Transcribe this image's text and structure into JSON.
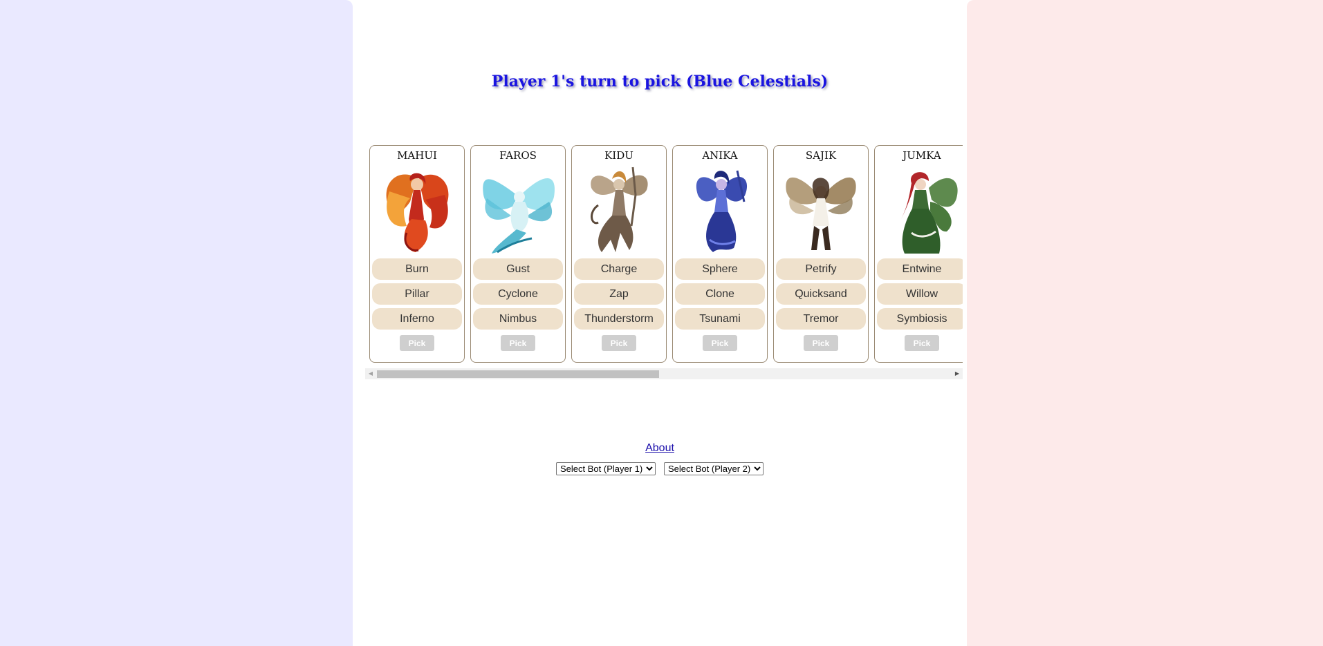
{
  "turn_title": "Player 1's turn to pick (Blue Celestials)",
  "cards": [
    {
      "name": "MAHUI",
      "image": "fire-fairy-portrait",
      "spells": [
        "Burn",
        "Pillar",
        "Inferno"
      ],
      "pick_label": "Pick"
    },
    {
      "name": "FAROS",
      "image": "wind-fairy-portrait",
      "spells": [
        "Gust",
        "Cyclone",
        "Nimbus"
      ],
      "pick_label": "Pick"
    },
    {
      "name": "KIDU",
      "image": "lightning-fairy-portrait",
      "spells": [
        "Charge",
        "Zap",
        "Thunderstorm"
      ],
      "pick_label": "Pick"
    },
    {
      "name": "ANIKA",
      "image": "water-fairy-portrait",
      "spells": [
        "Sphere",
        "Clone",
        "Tsunami"
      ],
      "pick_label": "Pick"
    },
    {
      "name": "SAJIK",
      "image": "earth-fairy-portrait",
      "spells": [
        "Petrify",
        "Quicksand",
        "Tremor"
      ],
      "pick_label": "Pick"
    },
    {
      "name": "JUMKA",
      "image": "nature-fairy-portrait",
      "spells": [
        "Entwine",
        "Willow",
        "Symbiosis"
      ],
      "pick_label": "Pick"
    }
  ],
  "about_link": "About",
  "bot_select_p1": "Select Bot (Player 1)",
  "bot_select_p2": "Select Bot (Player 2)",
  "colors": {
    "left_panel": "#eae9ff",
    "right_panel": "#fdeaea",
    "title": "#1a14e0",
    "spell_bg": "#efe1cc",
    "pick_button": "#cfcfcf"
  }
}
